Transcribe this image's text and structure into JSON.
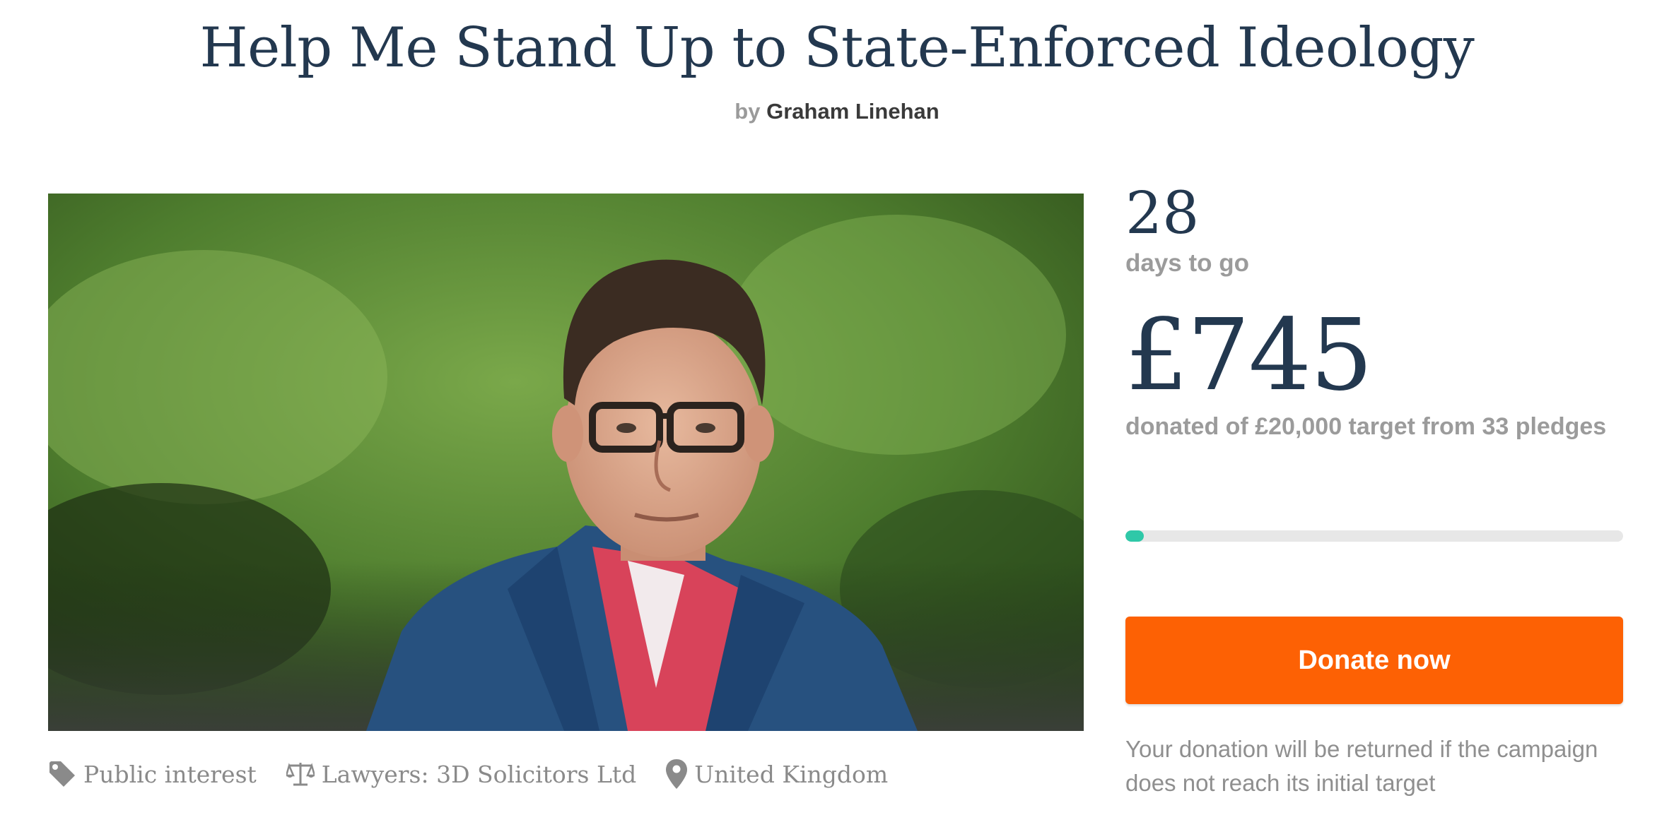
{
  "campaign": {
    "title": "Help Me Stand Up to State-Enforced Ideology",
    "by_label": "by",
    "author": "Graham Linehan"
  },
  "meta": {
    "category": "Public interest",
    "category_icon": "tag-icon",
    "lawyers": "Lawyers: 3D Solicitors Ltd",
    "lawyers_icon": "scales-icon",
    "location": "United Kingdom",
    "location_icon": "map-pin-icon"
  },
  "stats": {
    "days_left": "28",
    "days_label": "days to go",
    "amount": "£745",
    "amount_label": "donated of £20,000 target from 33 pledges",
    "progress_fraction": 0.037
  },
  "donate": {
    "label": "Donate now"
  },
  "refund_note": "Your donation will be returned if the campaign does not reach its initial target",
  "colors": {
    "title": "#23384f",
    "accent": "#fd6104",
    "progress": "#2fc8a8",
    "muted": "#9b9b9b"
  }
}
